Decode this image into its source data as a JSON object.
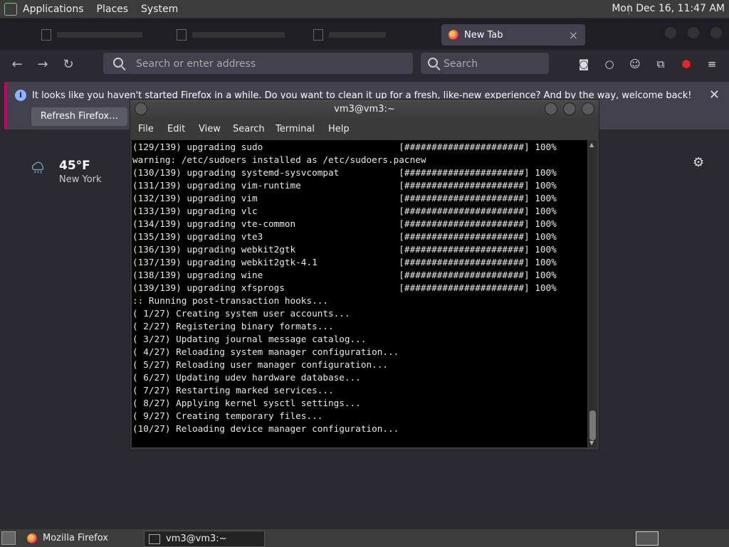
{
  "top_panel": {
    "menu": [
      "Applications",
      "Places",
      "System"
    ],
    "clock": "Mon Dec 16, 11:47 AM"
  },
  "browser": {
    "active_tab": "New Tab",
    "tab_close": "×",
    "url_placeholder": "Search or enter address",
    "search_placeholder": "Search",
    "notification": {
      "message": "It looks like you haven't started Firefox in a while. Do you want to clean it up for a fresh, like-new experience? And by the way, welcome back!",
      "button": "Refresh Firefox…",
      "close": "✕"
    },
    "weather": {
      "temp": "45°F",
      "city": "New York"
    }
  },
  "terminal": {
    "title": "vm3@vm3:~",
    "menu": [
      "File",
      "Edit",
      "View",
      "Search",
      "Terminal",
      "Help"
    ],
    "lines": [
      "(129/139) upgrading sudo                         [######################] 100%",
      "warning: /etc/sudoers installed as /etc/sudoers.pacnew",
      "(130/139) upgrading systemd-sysvcompat           [######################] 100%",
      "(131/139) upgrading vim-runtime                  [######################] 100%",
      "(132/139) upgrading vim                          [######################] 100%",
      "(133/139) upgrading vlc                          [######################] 100%",
      "(134/139) upgrading vte-common                   [######################] 100%",
      "(135/139) upgrading vte3                         [######################] 100%",
      "(136/139) upgrading webkit2gtk                   [######################] 100%",
      "(137/139) upgrading webkit2gtk-4.1               [######################] 100%",
      "(138/139) upgrading wine                         [######################] 100%",
      "(139/139) upgrading xfsprogs                     [######################] 100%",
      ":: Running post-transaction hooks...",
      "( 1/27) Creating system user accounts...",
      "( 2/27) Registering binary formats...",
      "( 3/27) Updating journal message catalog...",
      "( 4/27) Reloading system manager configuration...",
      "( 5/27) Reloading user manager configuration...",
      "( 6/27) Updating udev hardware database...",
      "( 7/27) Restarting marked services...",
      "( 8/27) Applying kernel sysctl settings...",
      "( 9/27) Creating temporary files...",
      "(10/27) Reloading device manager configuration..."
    ]
  },
  "taskbar": {
    "firefox": "Mozilla Firefox",
    "terminal": "vm3@vm3:~"
  },
  "icons": [
    "firefox-icon",
    "back-icon",
    "forward-icon",
    "reload-icon",
    "search-icon",
    "pocket-icon",
    "account-icon",
    "extensions-icon",
    "ublock-icon",
    "menu-icon",
    "info-icon",
    "cloud-rain-icon",
    "gear-icon"
  ]
}
